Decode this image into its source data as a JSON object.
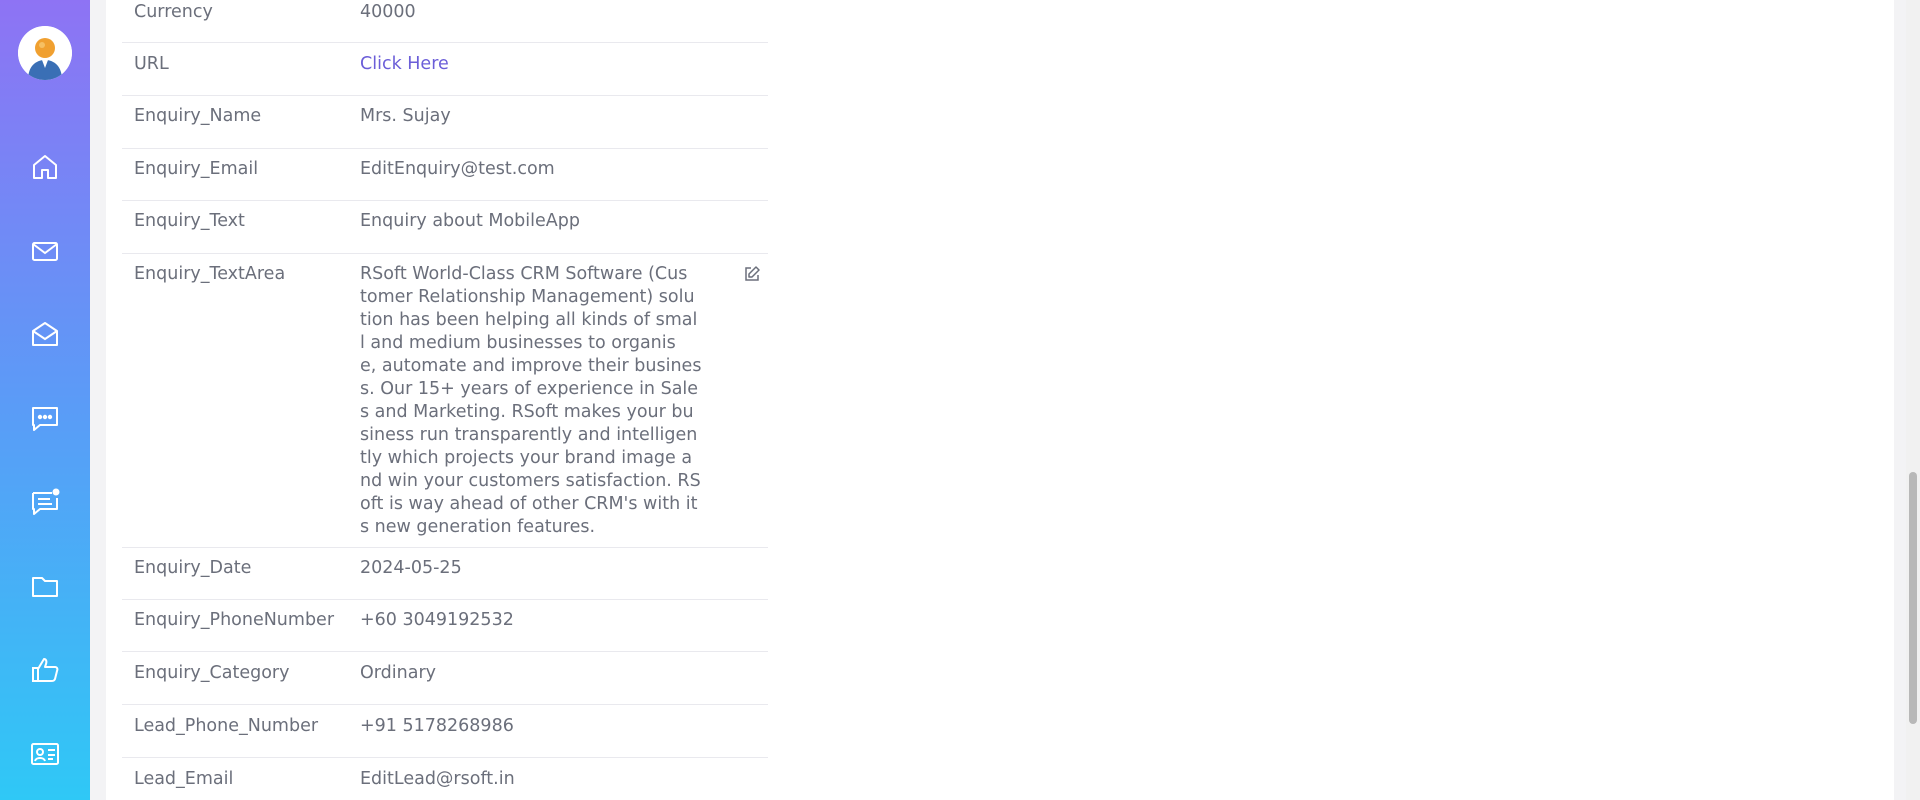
{
  "sidebar": {
    "avatar": "user-avatar",
    "items": [
      {
        "name": "home-icon"
      },
      {
        "name": "mail-icon"
      },
      {
        "name": "mail-open-icon"
      },
      {
        "name": "chat-icon"
      },
      {
        "name": "notification-chat-icon"
      },
      {
        "name": "folder-icon"
      },
      {
        "name": "thumbs-up-icon"
      },
      {
        "name": "contact-card-icon"
      }
    ]
  },
  "details": {
    "rows": [
      {
        "label": "Currency",
        "value": " 40000"
      },
      {
        "label": "URL",
        "value": "Click Here"
      },
      {
        "label": "Enquiry_Name",
        "value": "Mrs.   Sujay"
      },
      {
        "label": "Enquiry_Email",
        "value": "EditEnquiry@test.com"
      },
      {
        "label": "Enquiry_Text",
        "value": "Enquiry about MobileApp"
      },
      {
        "label": "Enquiry_TextArea",
        "value": "RSoft World-Class CRM Software (Cus\ntomer Relationship Management) solu\ntion has been helping all kinds of smal\nl and medium businesses to organis\ne, automate and improve their busines\ns. Our 15+ years of experience in Sale\ns and Marketing. RSoft makes your bu\nsiness run transparently and intelligen\ntly which projects your brand image a\nnd win your customers satisfaction. RS\noft is way ahead of other CRM's with it\ns new generation features."
      },
      {
        "label": "Enquiry_Date",
        "value": "2024-05-25"
      },
      {
        "label": "Enquiry_PhoneNumber",
        "value": "+60   3049192532"
      },
      {
        "label": "Enquiry_Category",
        "value": "Ordinary"
      },
      {
        "label": "Lead_Phone_Number",
        "value": "+91   5178268986"
      },
      {
        "label": "Lead_Email",
        "value": "EditLead@rsoft.in"
      }
    ],
    "edit_icon": "edit-icon"
  },
  "colors": {
    "sidebar_top": "#8e73f4",
    "sidebar_bottom": "#2fc8f6",
    "link": "#6b5ed8",
    "text": "#6b6f7b"
  }
}
